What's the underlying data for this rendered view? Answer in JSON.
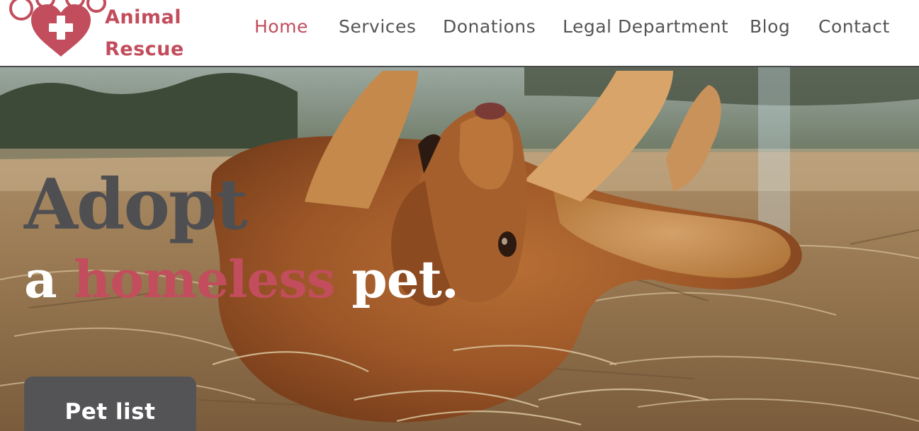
{
  "brand": {
    "line1": "Animal",
    "line2": "Rescue",
    "color": "#c24d5c"
  },
  "nav": {
    "items": [
      {
        "label": "Home",
        "active": true
      },
      {
        "label": "Services",
        "active": false
      },
      {
        "label": "Donations",
        "active": false
      },
      {
        "label": "Legal Department",
        "active": false
      },
      {
        "label": "Blog",
        "active": false
      },
      {
        "label": "Contact",
        "active": false
      }
    ]
  },
  "hero": {
    "headline_line1": "Adopt",
    "headline_line2_pre": "a ",
    "headline_line2_accent": "homeless",
    "headline_line2_post": " pet.",
    "cta_label": "Pet list"
  },
  "colors": {
    "accent": "#c24d5c",
    "text_dark": "#4f4f52",
    "nav_text": "#555555",
    "button_bg": "#545456"
  },
  "icons": [
    "paw-heart-logo-icon"
  ]
}
